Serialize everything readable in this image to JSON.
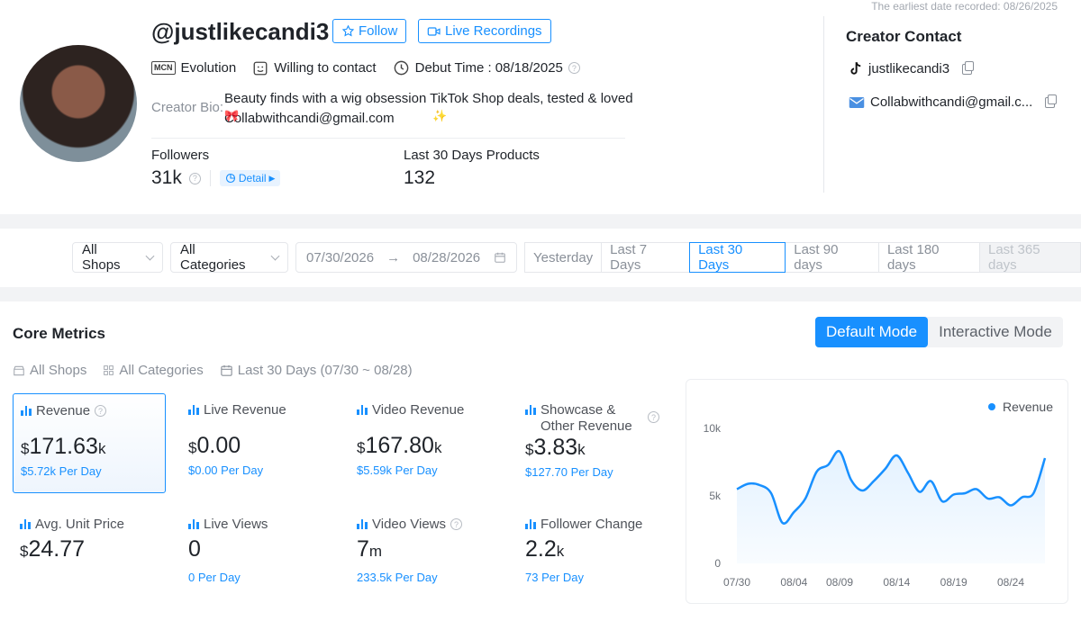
{
  "colors": {
    "accent": "#1890ff",
    "text": "#1f2329",
    "muted": "#8a9099",
    "page_bg": "#f2f3f5"
  },
  "profile": {
    "earliest_date": "The earliest date recorded: 08/26/2025",
    "handle": "@justlikecandi3",
    "follow_label": "Follow",
    "live_recordings_label": "Live Recordings",
    "mcn_badge": "MCN",
    "mcn_label": "Evolution",
    "contact_status": "Willing to contact",
    "debut_time": "Debut Time : 08/18/2025",
    "bio_label": "Creator Bio:",
    "bio_text": "Beauty finds with a wig obsession TikTok Shop deals, tested & loved Collabwithcandi@gmail.com",
    "followers_label": "Followers",
    "followers_value": "31k",
    "detail_label": "Detail",
    "products_label": "Last 30 Days Products",
    "products_value": "132"
  },
  "contact": {
    "title": "Creator Contact",
    "tiktok": "justlikecandi3",
    "email": "Collabwithcandi@gmail.c..."
  },
  "filters": {
    "shops": "All Shops",
    "categories": "All Categories",
    "date_start": "07/30/2026",
    "date_end": "08/28/2026",
    "ranges": [
      {
        "label": "Yesterday",
        "state": "normal"
      },
      {
        "label": "Last 7 Days",
        "state": "normal"
      },
      {
        "label": "Last 30 Days",
        "state": "active"
      },
      {
        "label": "Last 90 days",
        "state": "normal"
      },
      {
        "label": "Last 180 days",
        "state": "normal"
      },
      {
        "label": "Last 365 days",
        "state": "disabled"
      }
    ]
  },
  "metrics": {
    "title": "Core Metrics",
    "mode_default": "Default Mode",
    "mode_interactive": "Interactive Mode",
    "scope_shops": "All Shops",
    "scope_categories": "All Categories",
    "scope_period": "Last 30 Days (07/30 ~ 08/28)",
    "cards": [
      {
        "label": "Revenue",
        "prefix": "$",
        "value": "171.63",
        "suffix": "k",
        "sub": "$5.72k Per Day"
      },
      {
        "label": "Live Revenue",
        "prefix": "$",
        "value": "0.00",
        "suffix": "",
        "sub": "$0.00 Per Day"
      },
      {
        "label": "Video Revenue",
        "prefix": "$",
        "value": "167.80",
        "suffix": "k",
        "sub": "$5.59k Per Day"
      },
      {
        "label": "Showcase & Other Revenue",
        "prefix": "$",
        "value": "3.83",
        "suffix": "k",
        "sub": "$127.70 Per Day"
      },
      {
        "label": "Avg. Unit Price",
        "prefix": "$",
        "value": "24.77",
        "suffix": "",
        "sub": ""
      },
      {
        "label": "Live Views",
        "prefix": "",
        "value": "0",
        "suffix": "",
        "sub": "0 Per Day"
      },
      {
        "label": "Video Views",
        "prefix": "",
        "value": "7",
        "suffix": "m",
        "sub": "233.5k Per Day"
      },
      {
        "label": "Follower Change",
        "prefix": "",
        "value": "2.2",
        "suffix": "k",
        "sub": "73 Per Day"
      }
    ]
  },
  "chart_data": {
    "type": "area",
    "series": [
      {
        "name": "Revenue",
        "values": [
          5500,
          5900,
          5800,
          5200,
          3000,
          3800,
          4800,
          6800,
          7300,
          8300,
          6200,
          5400,
          6100,
          7000,
          8000,
          6700,
          5300,
          6100,
          4600,
          5100,
          5200,
          5500,
          4800,
          4900,
          4300,
          4900,
          5200,
          7800
        ]
      }
    ],
    "x": [
      "07/30",
      "07/31",
      "08/01",
      "08/02",
      "08/03",
      "08/04",
      "08/05",
      "08/06",
      "08/07",
      "08/09",
      "08/10",
      "08/11",
      "08/12",
      "08/13",
      "08/14",
      "08/15",
      "08/16",
      "08/17",
      "08/18",
      "08/19",
      "08/20",
      "08/21",
      "08/22",
      "08/23",
      "08/24",
      "08/25",
      "08/26",
      "08/28"
    ],
    "xticks": [
      "07/30",
      "08/04",
      "08/09",
      "08/14",
      "08/19",
      "08/24"
    ],
    "yticks": [
      "0",
      "5k",
      "10k"
    ],
    "ylim": [
      0,
      10000
    ],
    "grid": false,
    "legend": "top-right"
  }
}
